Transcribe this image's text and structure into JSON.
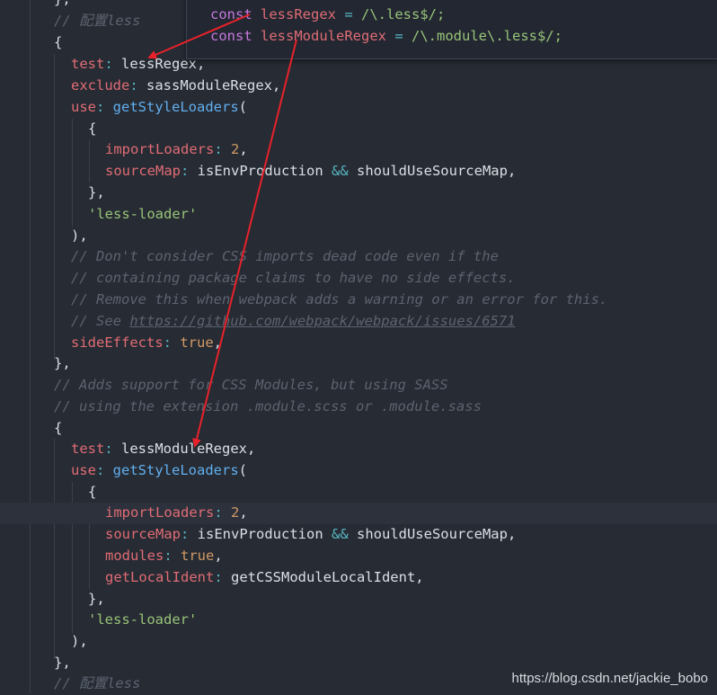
{
  "colors": {
    "background": "#272b33",
    "comment": "#5c6370",
    "keyword": "#c678dd",
    "property": "#e06c75",
    "function": "#61afef",
    "number": "#d19a66",
    "string": "#98c379",
    "operator": "#56b6c2",
    "arrow": "#e8222b"
  },
  "popup": {
    "line1": {
      "kw": "const",
      "name": "lessRegex",
      "eq": " = ",
      "val": "/\\.less$/;"
    },
    "line2": {
      "kw": "const",
      "name": "lessModuleRegex",
      "eq": " = ",
      "val": "/\\.module\\.less$/;"
    }
  },
  "code": {
    "l00": "},",
    "l01": "// 配置less",
    "l02": "{",
    "l03a": "test",
    "l03b": ": ",
    "l03c": "lessRegex,",
    "l04a": "exclude",
    "l04b": ": ",
    "l04c": "sassModuleRegex,",
    "l05a": "use",
    "l05b": ": ",
    "l05c": "getStyleLoaders",
    "l05d": "(",
    "l06": "{",
    "l07a": "importLoaders",
    "l07b": ": ",
    "l07c": "2",
    "l07d": ",",
    "l08a": "sourceMap",
    "l08b": ": ",
    "l08c": "isEnvProduction ",
    "l08d": "&&",
    "l08e": " shouldUseSourceMap,",
    "l09": "},",
    "l10": "'less-loader'",
    "l11": "),",
    "l12": "// Don't consider CSS imports dead code even if the",
    "l13": "// containing package claims to have no side effects.",
    "l14": "// Remove this when webpack adds a warning or an error for this.",
    "l15a": "// See ",
    "l15b": "https://github.com/webpack/webpack/issues/6571",
    "l16a": "sideEffects",
    "l16b": ": ",
    "l16c": "true",
    "l16d": ",",
    "l17": "},",
    "l18": "// Adds support for CSS Modules, but using SASS",
    "l19": "// using the extension .module.scss or .module.sass",
    "l20": "{",
    "l21a": "test",
    "l21b": ": ",
    "l21c": "lessModuleRegex,",
    "l22a": "use",
    "l22b": ": ",
    "l22c": "getStyleLoaders",
    "l22d": "(",
    "l23": "{",
    "l24a": "importLoaders",
    "l24b": ": ",
    "l24c": "2",
    "l24d": ",",
    "l25a": "sourceMap",
    "l25b": ": ",
    "l25c": "isEnvProduction ",
    "l25d": "&&",
    "l25e": " shouldUseSourceMap,",
    "l26a": "modules",
    "l26b": ": ",
    "l26c": "true",
    "l26d": ",",
    "l27a": "getLocalIdent",
    "l27b": ": ",
    "l27c": "getCSSModuleLocalIdent,",
    "l28": "},",
    "l29": "'less-loader'",
    "l30": "),",
    "l31": "},",
    "l32": "// 配置less"
  },
  "watermark": "https://blog.csdn.net/jackie_bobo"
}
